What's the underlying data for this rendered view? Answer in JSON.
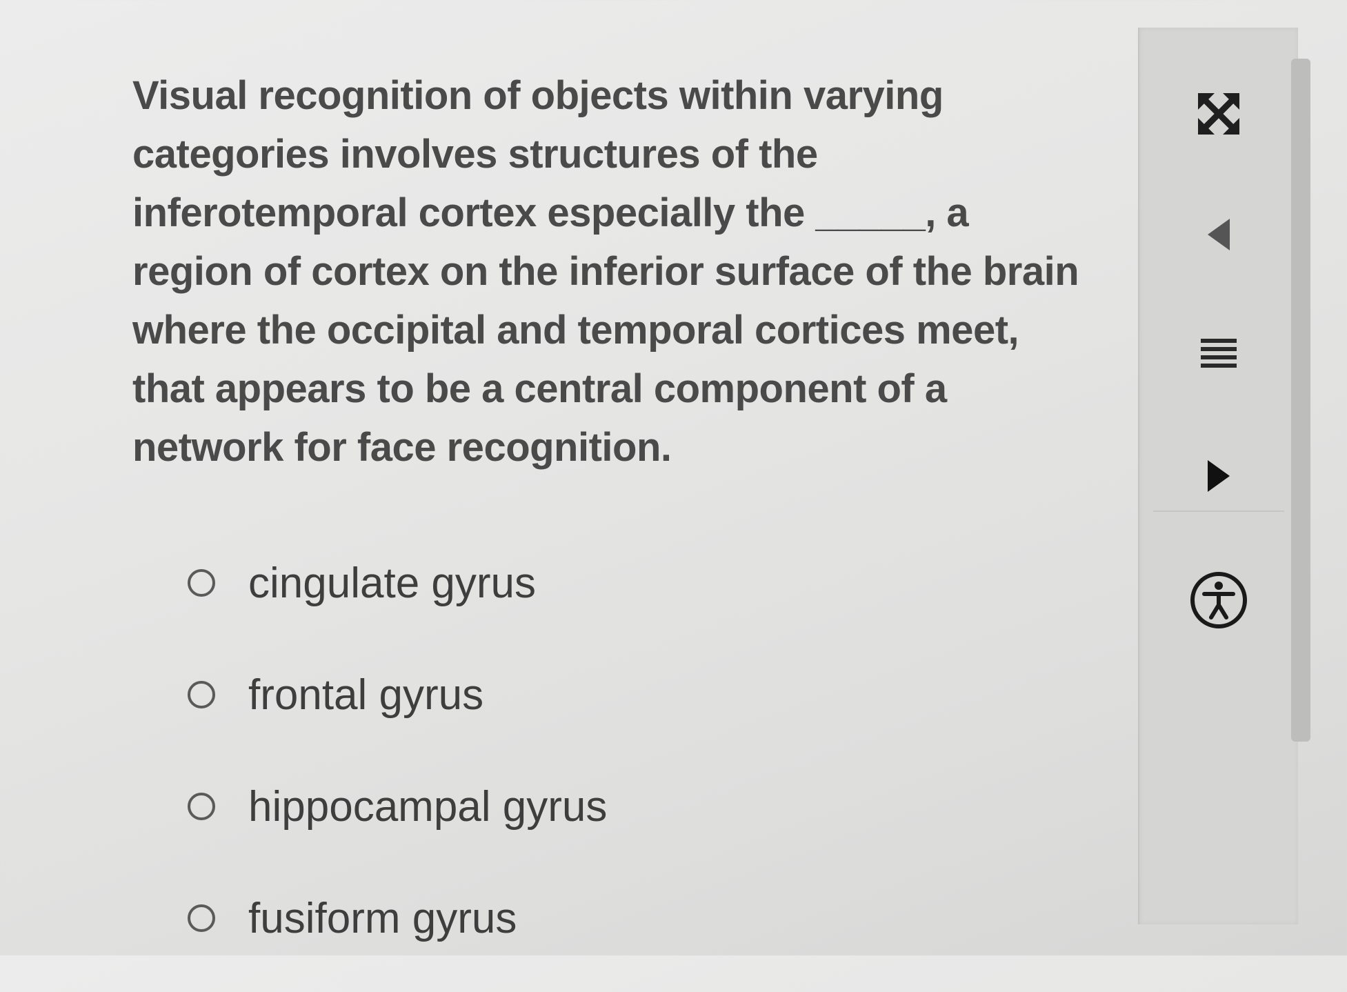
{
  "question": {
    "lines": [
      "Visual recognition of objects within varying",
      "categories involves structures of the",
      "inferotemporal cortex especially the _____, a",
      "region of cortex on the inferior surface of the brain",
      "where the occipital and temporal cortices meet,",
      "that appears to be a central component of a",
      "network for face recognition."
    ]
  },
  "options": [
    {
      "label": "cingulate gyrus"
    },
    {
      "label": "frontal gyrus"
    },
    {
      "label": "hippocampal gyrus"
    },
    {
      "label": "fusiform gyrus"
    }
  ],
  "toolbar": {
    "icons": [
      "expand-icon",
      "previous-icon",
      "menu-icon",
      "next-icon",
      "accessibility-icon"
    ]
  }
}
